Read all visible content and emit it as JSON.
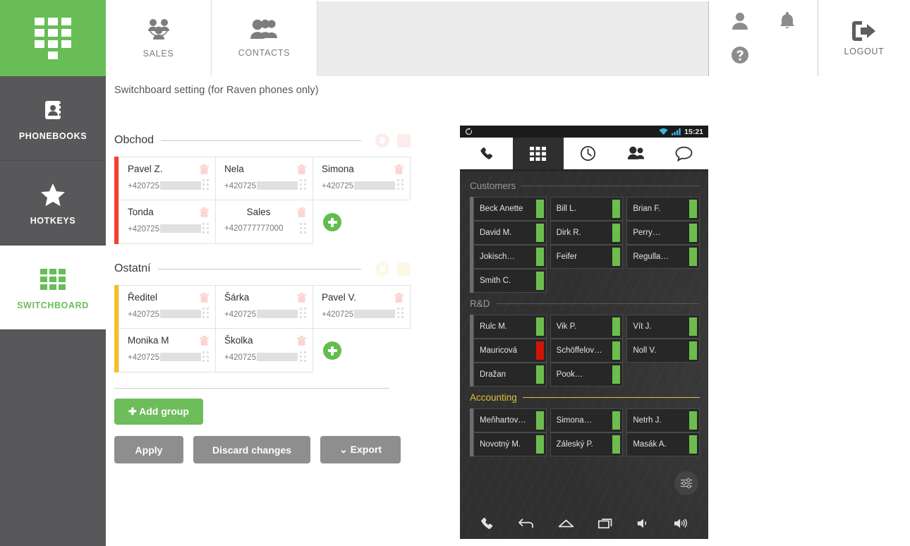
{
  "rail": {
    "logo_icon": "dialpad-icon",
    "items": [
      {
        "label": "PHONEBOOKS",
        "icon": "address-book-icon",
        "active": false
      },
      {
        "label": "HOTKEYS",
        "icon": "star-icon",
        "active": false
      },
      {
        "label": "SWITCHBOARD",
        "icon": "grid-icon",
        "active": true
      }
    ]
  },
  "header": {
    "tabs": [
      {
        "label": "SALES",
        "icon": "group-circle-icon"
      },
      {
        "label": "CONTACTS",
        "icon": "people-icon"
      }
    ],
    "user_icon": "user-icon",
    "bell_icon": "bell-icon",
    "help_icon": "question-circle-icon",
    "logout_label": "LOGOUT",
    "logout_icon": "logout-icon"
  },
  "main": {
    "page_title": "Switchboard setting (for Raven phones only)",
    "groups": [
      {
        "name": "Obchod",
        "bar_color": "#f4402f",
        "swatch_color": "#fdeceb",
        "trash_icon": "trash-icon",
        "contacts": [
          {
            "name": "Pavel Z.",
            "number": "+420725",
            "masked": true
          },
          {
            "name": "Nela",
            "number": "+420725",
            "masked": true
          },
          {
            "name": "Simona",
            "number": "+420725",
            "masked": true
          },
          {
            "name": "Tonda",
            "number": "+420725",
            "masked": true
          },
          {
            "name": "Sales",
            "number": "+420777777000",
            "masked": false,
            "centered": true
          }
        ],
        "add_label": "add-contact"
      },
      {
        "name": "Ostatní",
        "bar_color": "#f5c026",
        "swatch_color": "#fdf8e6",
        "trash_icon": "trash-icon",
        "contacts": [
          {
            "name": "Ředitel",
            "number": "+420725",
            "masked": true
          },
          {
            "name": "Šárka",
            "number": "+420725",
            "masked": true
          },
          {
            "name": "Pavel V.",
            "number": "+420725",
            "masked": true
          },
          {
            "name": "Monika M",
            "number": "+420725",
            "masked": true
          },
          {
            "name": "Školka",
            "number": "+420725",
            "masked": true
          }
        ],
        "add_label": "add-contact"
      }
    ],
    "add_group_label": "Add group",
    "apply_label": "Apply",
    "discard_label": "Discard changes",
    "export_label": "Export"
  },
  "phone": {
    "status": {
      "time": "15:21",
      "sync_icon": "sync-icon",
      "wifi_icon": "wifi-icon",
      "signal_icon": "signal-icon"
    },
    "tabs": [
      {
        "icon": "phone-icon",
        "active": false
      },
      {
        "icon": "grid-icon",
        "active": true
      },
      {
        "icon": "clock-icon",
        "active": false
      },
      {
        "icon": "contacts-icon",
        "active": false
      },
      {
        "icon": "chat-icon",
        "active": false
      }
    ],
    "sections": [
      {
        "title": "Customers",
        "accent": false,
        "entries": [
          {
            "name": "Beck Anette",
            "status": "#6dbd4e"
          },
          {
            "name": "Bill L.",
            "status": "#6dbd4e"
          },
          {
            "name": "Brian F.",
            "status": "#6dbd4e"
          },
          {
            "name": "David M.",
            "status": "#6dbd4e"
          },
          {
            "name": "Dirk R.",
            "status": "#6dbd4e"
          },
          {
            "name": "Perry…",
            "status": "#6dbd4e"
          },
          {
            "name": "Jokisch…",
            "status": "#6dbd4e"
          },
          {
            "name": "Feifer",
            "status": "#6dbd4e"
          },
          {
            "name": "Regulla…",
            "status": "#6dbd4e"
          },
          {
            "name": "Smith C.",
            "status": "#6dbd4e"
          }
        ]
      },
      {
        "title": "R&D",
        "accent": false,
        "entries": [
          {
            "name": "Rulc M.",
            "status": "#6dbd4e"
          },
          {
            "name": "Vik P.",
            "status": "#6dbd4e"
          },
          {
            "name": "Vít J.",
            "status": "#6dbd4e"
          },
          {
            "name": "Mauricová",
            "status": "#d01409"
          },
          {
            "name": "Schöffelov…",
            "status": "#6dbd4e"
          },
          {
            "name": "Noll V.",
            "status": "#6dbd4e"
          },
          {
            "name": "Dražan",
            "status": "#6dbd4e"
          },
          {
            "name": "Pook…",
            "status": "#6dbd4e"
          }
        ]
      },
      {
        "title": "Accounting",
        "accent": true,
        "entries": [
          {
            "name": "Meňhartov…",
            "status": "#6dbd4e"
          },
          {
            "name": "Simona…",
            "status": "#6dbd4e"
          },
          {
            "name": "Netrh J.",
            "status": "#6dbd4e"
          },
          {
            "name": "Novotný M.",
            "status": "#6dbd4e"
          },
          {
            "name": "Záleský P.",
            "status": "#6dbd4e"
          },
          {
            "name": "Masák A.",
            "status": "#6dbd4e"
          }
        ]
      }
    ],
    "fab_icon": "sliders-icon",
    "nav": [
      {
        "icon": "phone-icon"
      },
      {
        "icon": "back-icon"
      },
      {
        "icon": "home-icon"
      },
      {
        "icon": "recents-icon"
      },
      {
        "icon": "volume-down-icon"
      },
      {
        "icon": "volume-up-icon"
      }
    ]
  }
}
